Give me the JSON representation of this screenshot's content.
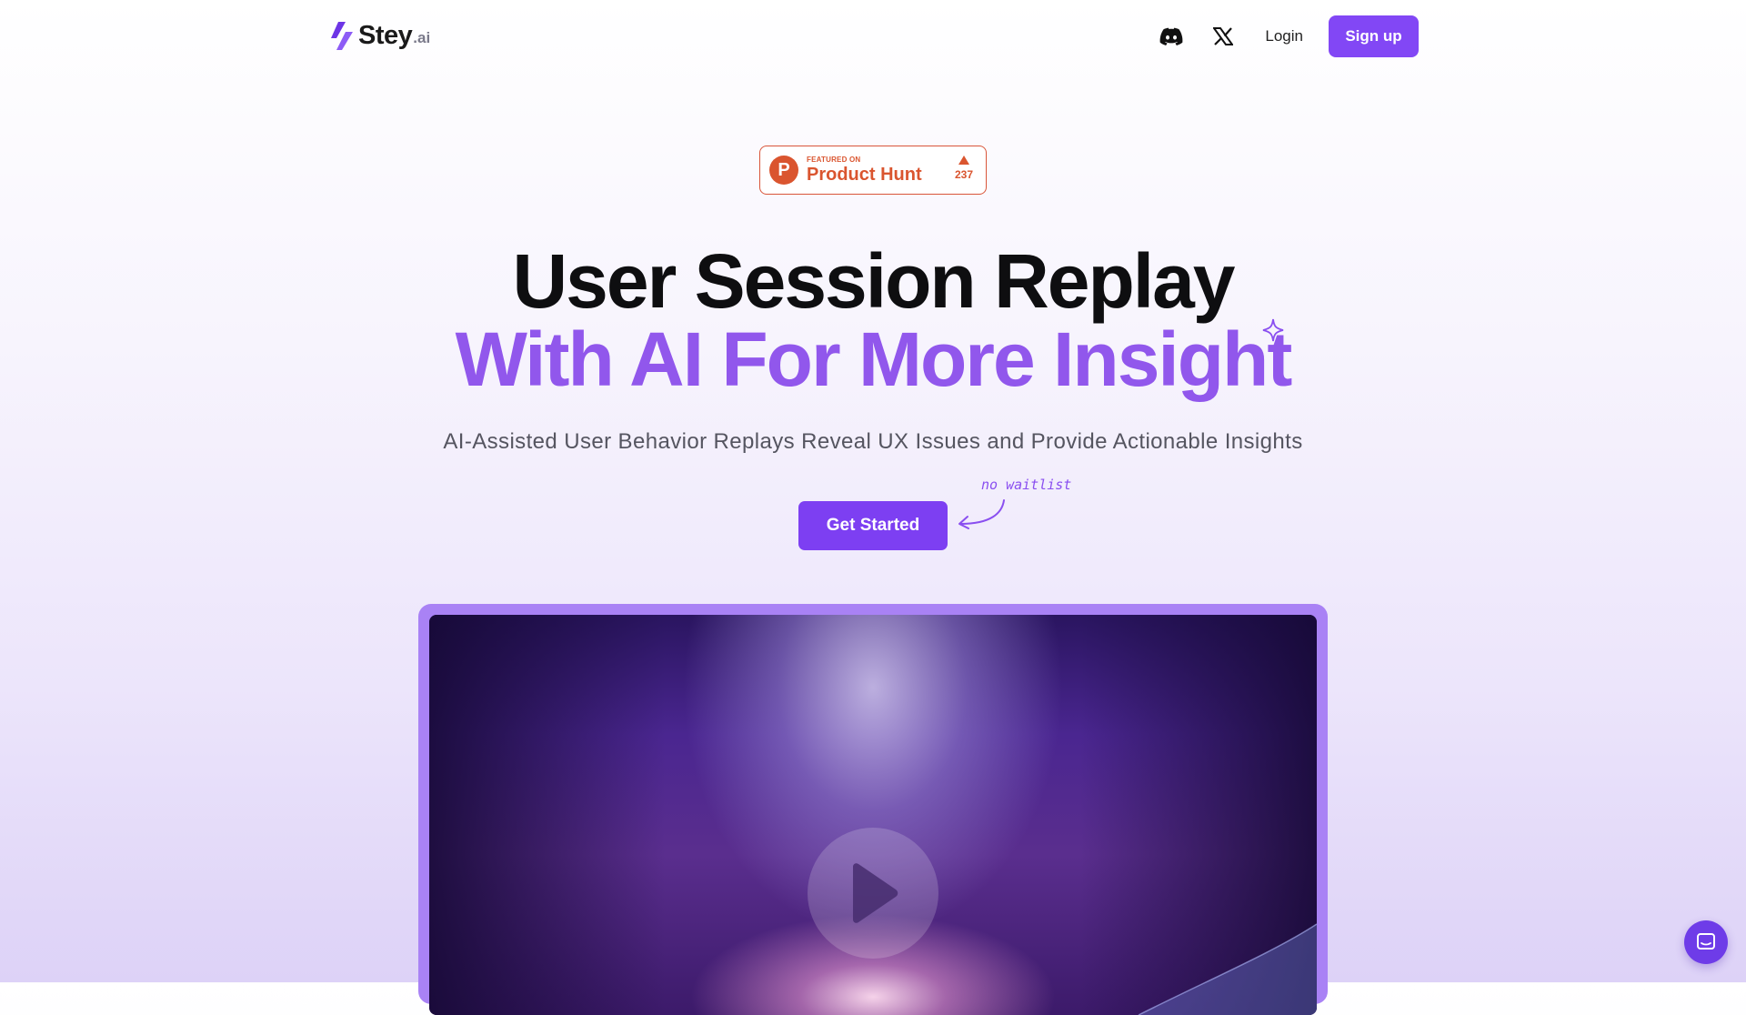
{
  "brand": {
    "name": "Stey",
    "suffix": ".ai"
  },
  "nav": {
    "discord_icon": "discord-icon",
    "x_icon": "x-twitter-icon",
    "login_label": "Login",
    "signup_label": "Sign up"
  },
  "product_hunt": {
    "featured_label": "FEATURED ON",
    "name": "Product Hunt",
    "logo_letter": "P",
    "votes": "237"
  },
  "hero": {
    "title_line1": "User Session Replay",
    "title_line2": "With AI For More Insight",
    "subtitle": "AI-Assisted User Behavior Replays Reveal UX Issues and Provide Actionable Insights",
    "cta_label": "Get Started",
    "note": "no waitlist"
  },
  "colors": {
    "accent": "#8247f5",
    "headline_purple": "#9157ec",
    "product_hunt": "#da552f"
  }
}
